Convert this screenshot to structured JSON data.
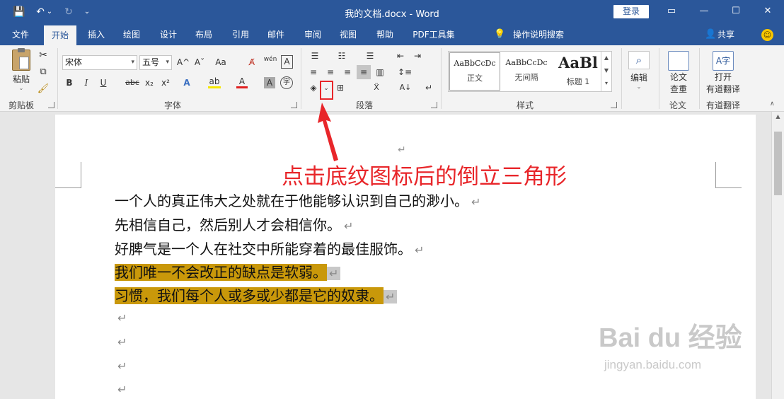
{
  "window": {
    "title": "我的文档.docx - Word",
    "login_label": "登录",
    "controls": {
      "ribbon_opts": "▭",
      "minimize": "—",
      "maximize": "☐",
      "close": "✕"
    }
  },
  "quick_access": {
    "save": "💾",
    "undo": "↶",
    "undo_dd": "⌄",
    "redo": "↻",
    "customize": "⌄"
  },
  "menu_tabs": [
    {
      "label": "文件"
    },
    {
      "label": "开始"
    },
    {
      "label": "插入"
    },
    {
      "label": "绘图"
    },
    {
      "label": "设计"
    },
    {
      "label": "布局"
    },
    {
      "label": "引用"
    },
    {
      "label": "邮件"
    },
    {
      "label": "审阅"
    },
    {
      "label": "视图"
    },
    {
      "label": "帮助"
    },
    {
      "label": "PDF工具集"
    }
  ],
  "active_tab": "开始",
  "tell_me": "操作说明搜索",
  "share_label": "共享",
  "ribbon": {
    "groups": {
      "clipboard": "剪贴板",
      "font": "字体",
      "paragraph": "段落",
      "styles": "样式",
      "paper": "论文",
      "translate": "有道翻译"
    },
    "paste_label": "粘贴",
    "font_name": "宋体",
    "font_size": "五号",
    "font_buttons": {
      "grow": "A^",
      "shrink": "Aˇ",
      "case": "Aa",
      "clear": "A̸",
      "phonetic": "wén",
      "border_char": "A",
      "bold": "B",
      "italic": "I",
      "underline": "U",
      "strike": "abc",
      "sub": "x₂",
      "sup": "x²",
      "effect": "A",
      "highlight": "ab",
      "font_color": "A",
      "shade_char": "A",
      "enclose": "字"
    },
    "styles": [
      {
        "sample": "AaBbCcDc",
        "name": "正文"
      },
      {
        "sample": "AaBbCcDc",
        "name": "无间隔"
      },
      {
        "sample": "AaBl",
        "name": "标题 1"
      }
    ],
    "edit_label": "编辑",
    "paper_label_1": "论文",
    "paper_label_2": "查重",
    "translate_label_1": "打开",
    "translate_label_2": "有道翻译"
  },
  "annotation": "点击底纹图标后的倒立三角形",
  "document": {
    "top_mark": "↵",
    "lines": [
      {
        "text": "一个人的真正伟大之处就在于他能够认识到自己的渺小。",
        "highlight": false
      },
      {
        "text": "先相信自己，然后别人才会相信你。",
        "highlight": false
      },
      {
        "text": "好脾气是一个人在社交中所能穿着的最佳服饰。",
        "highlight": false
      },
      {
        "text": "我们唯一不会改正的缺点是软弱。",
        "highlight": true
      },
      {
        "text": "习惯，我们每个人或多或少都是它的奴隶。",
        "highlight": true
      }
    ],
    "mark": "↵",
    "empty_marks": [
      "↵",
      "↵",
      "↵",
      "↵"
    ]
  },
  "watermark": {
    "brand": "Bai du 经验",
    "url": "jingyan.baidu.com"
  },
  "colors": {
    "accent": "#2b579a",
    "annotation": "#e8262a",
    "highlight": "#c9980a"
  }
}
